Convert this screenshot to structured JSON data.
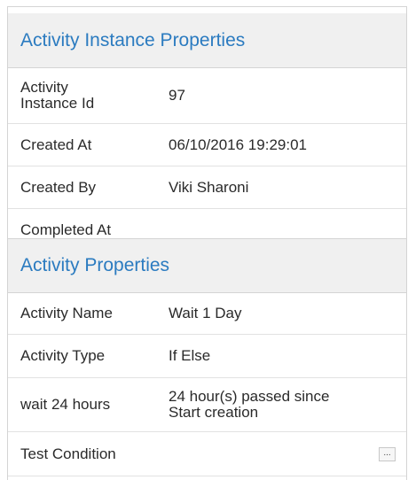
{
  "instance_section": {
    "title": "Activity Instance Properties",
    "rows": [
      {
        "label": "Activity\nInstance Id",
        "value": "97"
      },
      {
        "label": "Created At",
        "value": "06/10/2016 19:29:01"
      },
      {
        "label": "Created By",
        "value": "Viki Sharoni"
      },
      {
        "label": "Completed At",
        "value": ""
      }
    ]
  },
  "activity_section": {
    "title": "Activity Properties",
    "rows": [
      {
        "label": "Activity Name",
        "value": "Wait 1 Day"
      },
      {
        "label": "Activity Type",
        "value": "If Else"
      },
      {
        "label": "wait 24 hours",
        "value": "24 hour(s) passed since\nStart creation"
      },
      {
        "label": "Test Condition",
        "value": "",
        "button_label": "..."
      }
    ]
  }
}
